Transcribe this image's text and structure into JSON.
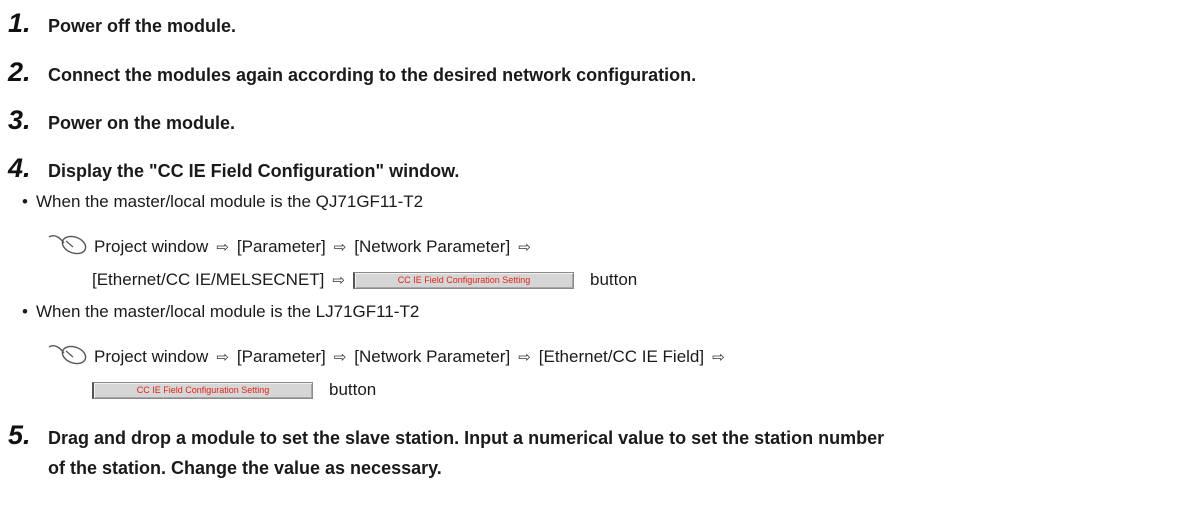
{
  "steps": [
    {
      "num": "1.",
      "text": "Power off the module."
    },
    {
      "num": "2.",
      "text": "Connect the modules again according to the desired network configuration."
    },
    {
      "num": "3.",
      "text": "Power on the module."
    },
    {
      "num": "4.",
      "text": "Display the \"CC IE Field Configuration\" window."
    },
    {
      "num": "5.",
      "text": "Drag and drop a module to set the slave station. Input a numerical value to set the station number",
      "text_cont": "of the station. Change the value as necessary."
    }
  ],
  "cases": [
    {
      "label": "When the master/local module is the QJ71GF11-T2"
    },
    {
      "label": "When the master/local module is the LJ71GF11-T2"
    }
  ],
  "path_a": {
    "line1": [
      "Project window",
      "[Parameter]",
      "[Network Parameter]"
    ],
    "line2": [
      "[Ethernet/CC IE/MELSECNET]"
    ]
  },
  "path_b": {
    "line1": [
      "Project window",
      "[Parameter]",
      "[Network Parameter]",
      "[Ethernet/CC IE Field]"
    ]
  },
  "config_button_label": "CC IE Field Configuration Setting",
  "button_word": "button",
  "arrow_glyph": "⇨",
  "icons": {
    "mouse": "mouse-operation-icon"
  }
}
